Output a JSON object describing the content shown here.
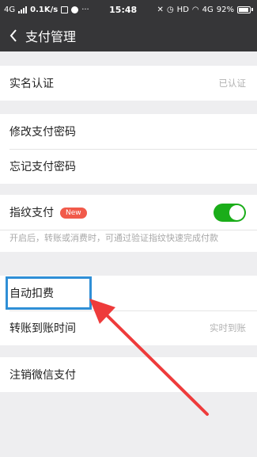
{
  "status_bar": {
    "network": "4G",
    "speed": "0.1K/s",
    "time": "15:48",
    "hd": "HD",
    "net_right": "4G",
    "battery": "92%",
    "battery_level": 0.92
  },
  "navbar": {
    "back_icon": "chevron-left-icon",
    "title": "支付管理"
  },
  "real_name": {
    "label": "实名认证",
    "value": "已认证"
  },
  "password": {
    "change_label": "修改支付密码",
    "forget_label": "忘记支付密码"
  },
  "fingerprint": {
    "label": "指纹支付",
    "badge": "New",
    "enabled": true,
    "description": "开启后，转账或消费时，可通过验证指纹快速完成付款"
  },
  "deduction": {
    "auto_label": "自动扣费",
    "transfer_label": "转账到账时间",
    "transfer_value": "实时到账"
  },
  "cancel": {
    "label": "注销微信支付"
  },
  "colors": {
    "bar_bg": "#363638",
    "page_bg": "#eeeef0",
    "toggle_on": "#1aad19",
    "badge": "#f15a4a",
    "highlight": "#2f8fd6",
    "arrow": "#ee3b3b"
  }
}
